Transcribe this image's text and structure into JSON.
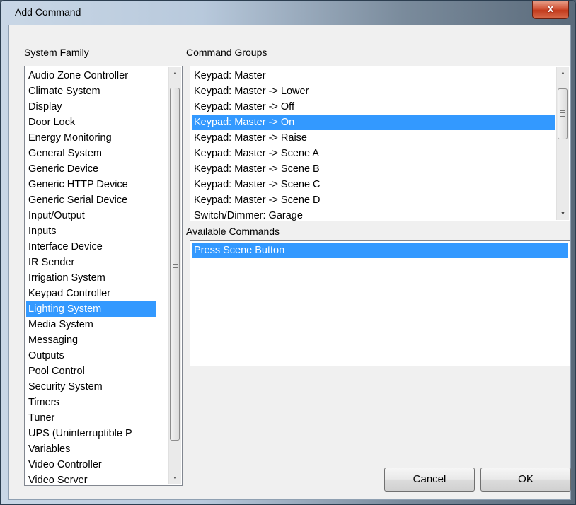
{
  "window": {
    "title": "Add Command",
    "close_glyph": "x"
  },
  "system_family": {
    "label": "System Family",
    "items": [
      "Audio Zone Controller",
      "Climate System",
      "Display",
      "Door Lock",
      "Energy Monitoring",
      "General System",
      "Generic Device",
      "Generic HTTP Device",
      "Generic Serial Device",
      "Input/Output",
      "Inputs",
      "Interface Device",
      "IR Sender",
      "Irrigation System",
      "Keypad Controller",
      "Lighting System",
      "Media System",
      "Messaging",
      "Outputs",
      "Pool Control",
      "Security System",
      "Timers",
      "Tuner",
      "UPS (Uninterruptible P",
      "Variables",
      "Video Controller",
      "Video Server"
    ],
    "selected": "Lighting System"
  },
  "command_groups": {
    "label": "Command Groups",
    "items": [
      "Keypad: Master",
      "Keypad: Master -> Lower",
      "Keypad: Master -> Off",
      "Keypad: Master -> On",
      "Keypad: Master -> Raise",
      "Keypad: Master -> Scene A",
      "Keypad: Master -> Scene B",
      "Keypad: Master -> Scene C",
      "Keypad: Master -> Scene D",
      "Switch/Dimmer: Garage"
    ],
    "selected": "Keypad: Master -> On"
  },
  "available_commands": {
    "label": "Available Commands",
    "items": [
      "Press Scene Button"
    ],
    "selected": "Press Scene Button"
  },
  "buttons": {
    "cancel": "Cancel",
    "ok": "OK"
  },
  "colors": {
    "selection": "#3399ff",
    "dialog_bg": "#f0f0f0",
    "close_button": "#c23a1c"
  },
  "icons": {
    "close": "close-icon",
    "scroll_up": "chevron-up-icon",
    "scroll_down": "chevron-down-icon"
  }
}
